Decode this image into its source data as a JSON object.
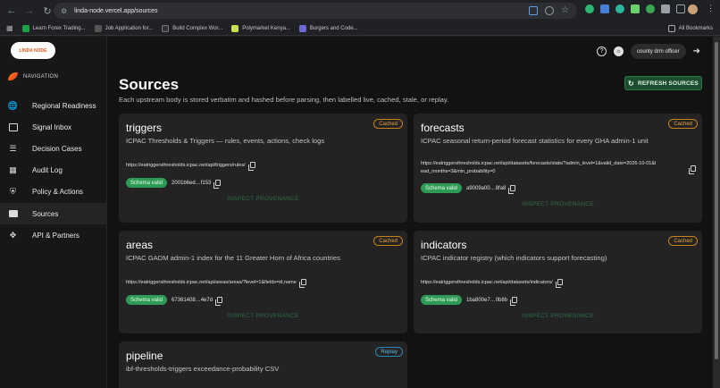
{
  "browser": {
    "url": "linda-node.vercel.app/sources",
    "bookmarks": [
      {
        "label": "Learn Forex Trading...",
        "color": "#1aa34a"
      },
      {
        "label": "Job Application for...",
        "color": "#555555"
      },
      {
        "label": "Build Complex Wor...",
        "color": "#333333"
      },
      {
        "label": "Polymarket Kenya...",
        "color": "#c8e04a"
      },
      {
        "label": "Burgers and Code...",
        "color": "#6b6bd6"
      }
    ],
    "all_bookmarks": "All Bookmarks"
  },
  "brand": {
    "logo_text": "LINDA NODE"
  },
  "sidebar": {
    "header": "NAVIGATION",
    "items": [
      {
        "label": "Regional Readiness",
        "icon": "globe-icon",
        "active": false
      },
      {
        "label": "Signal Inbox",
        "icon": "inbox-icon",
        "active": false
      },
      {
        "label": "Decision Cases",
        "icon": "cases-icon",
        "active": false
      },
      {
        "label": "Audit Log",
        "icon": "audit-icon",
        "active": false
      },
      {
        "label": "Policy & Actions",
        "icon": "shield-icon",
        "active": false
      },
      {
        "label": "Sources",
        "icon": "sources-icon",
        "active": true
      },
      {
        "label": "API & Partners",
        "icon": "api-icon",
        "active": false
      }
    ]
  },
  "topbar": {
    "user": "county drm officer"
  },
  "page": {
    "title": "Sources",
    "subtitle": "Each upstream body is stored verbatim and hashed before parsing, then labelled live, cached, stale, or replay.",
    "refresh_label": "REFRESH SOURCES"
  },
  "cards": [
    {
      "title": "triggers",
      "desc": "ICPAC Thresholds & Triggers — rules, events, actions, check logs",
      "badge": "Cached",
      "url": "https://eatriggersthresholds.icpac.net/api/triggers/rules/",
      "schema": "Schema valid",
      "hash": "2001b6ed…f153",
      "inspect": "INSPECT PROVENANCE"
    },
    {
      "title": "forecasts",
      "desc": "ICPAC seasonal return-period forecast statistics for every GHA admin-1 unit",
      "badge": "Cached",
      "url_line1": "https://eatriggersthresholds.icpac.net/api/datasets/forecasts/stats/?admin_level=1&valid_date=2026-10-01&l",
      "url_line2": "ead_months=3&min_probability=0",
      "schema": "Schema valid",
      "hash": "a9009a00…8fa8",
      "inspect": "INSPECT PROVENANCE"
    },
    {
      "title": "areas",
      "desc": "ICPAC GADM admin-1 index for the 11 Greater Horn of Africa countries",
      "badge": "Cached",
      "url": "https://eatriggersthresholds.icpac.net/api/areas/areas/?level=1&fields=id,name",
      "schema": "Schema valid",
      "hash": "67361408…4e7d",
      "inspect": "INSPECT PROVENANCE"
    },
    {
      "title": "indicators",
      "desc": "ICPAC indicator registry (which indicators support forecasting)",
      "badge": "Cached",
      "url": "https://eatriggersthresholds.icpac.net/api/datasets/indicators/",
      "schema": "Schema valid",
      "hash": "1ba800e7…0b8b",
      "inspect": "INSPECT PROVENANCE"
    },
    {
      "title": "pipeline",
      "desc": "ibf-thresholds-triggers exceedance-probability CSV",
      "badge": "Replay"
    }
  ]
}
